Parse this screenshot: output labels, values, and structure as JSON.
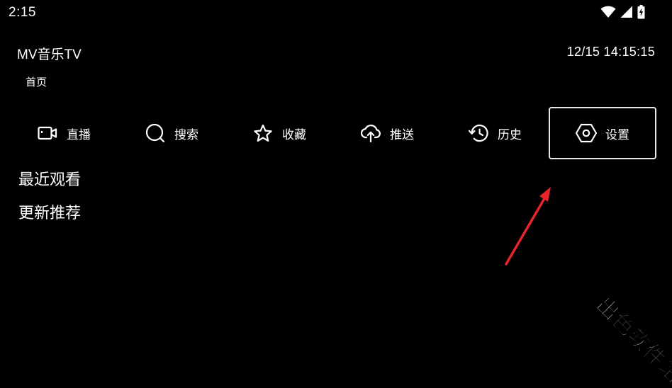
{
  "status_bar": {
    "time": "2:15",
    "icons": [
      "wifi-icon",
      "signal-icon",
      "battery-charging-icon"
    ]
  },
  "header": {
    "app_title": "MV音乐TV",
    "clock": "12/15 14:15:15",
    "breadcrumb": "首页"
  },
  "nav": {
    "selected_index": 5,
    "items": [
      {
        "label": "直播",
        "icon": "video-camera-icon"
      },
      {
        "label": "搜索",
        "icon": "search-icon"
      },
      {
        "label": "收藏",
        "icon": "star-icon"
      },
      {
        "label": "推送",
        "icon": "cloud-upload-icon"
      },
      {
        "label": "历史",
        "icon": "history-icon"
      },
      {
        "label": "设置",
        "icon": "settings-hexagon-icon"
      }
    ]
  },
  "sections": [
    {
      "label": "最近观看"
    },
    {
      "label": "更新推荐"
    }
  ],
  "annotation": {
    "arrow_color": "#e8232a"
  },
  "watermark": {
    "text": "出色软件站"
  },
  "colors": {
    "background": "#000000",
    "foreground": "#ffffff",
    "focus_border": "#e8e8e8"
  }
}
